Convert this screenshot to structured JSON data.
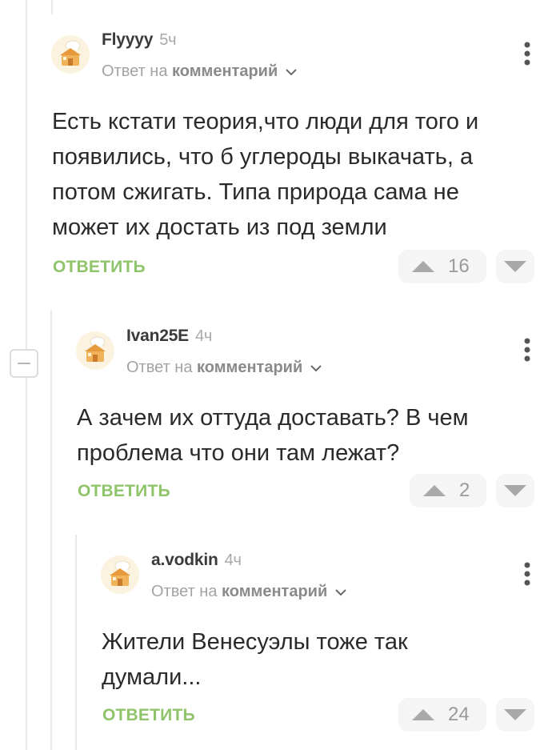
{
  "comments": [
    {
      "author": "Flyyyy",
      "time": "5ч",
      "reply_prefix": "Ответ на",
      "reply_target": "комментарий",
      "text_lines": [
        "Есть кстати теория,что люди для того и",
        "появились, что б углероды выкачать, а",
        "потом сжигать. Типа природа сама не",
        "может их достать из под земли"
      ],
      "reply_label": "ОТВЕТИТЬ",
      "votes": "16"
    },
    {
      "author": "Ivan25E",
      "time": "4ч",
      "reply_prefix": "Ответ на",
      "reply_target": "комментарий",
      "text_lines": [
        "А зачем их оттуда доставать? В чем",
        "проблема что они там лежат?"
      ],
      "reply_label": "ОТВЕТИТЬ",
      "votes": "2"
    },
    {
      "author": "a.vodkin",
      "time": "4ч",
      "reply_prefix": "Ответ на",
      "reply_target": "комментарий",
      "text_lines": [
        "Жители Венесуэлы тоже так",
        "думали..."
      ],
      "reply_label": "ОТВЕТИТЬ",
      "votes": "24"
    }
  ],
  "colors": {
    "accent_green": "#8fc46a",
    "muted_text": "#a3a3a3",
    "vote_bg": "#f5f5f5",
    "thread_line": "#e9e9e9"
  },
  "icons": {
    "avatar": "chef-hat-house-avatar-icon",
    "more": "vertical-dots-icon",
    "upvote": "triangle-up-icon",
    "downvote": "triangle-down-icon",
    "chevron": "chevron-down-icon",
    "collapse": "minus-icon"
  }
}
